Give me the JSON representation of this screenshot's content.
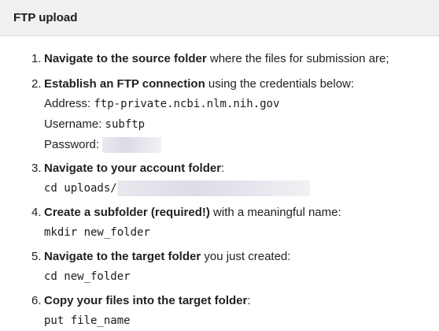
{
  "header": {
    "title": "FTP upload"
  },
  "steps": [
    {
      "num": "1.",
      "bold": "Navigate to the source folder",
      "rest": " where the files for submission are;"
    },
    {
      "num": "2.",
      "bold": "Establish an FTP connection",
      "rest": " using the credentials below:",
      "address_label": "Address:",
      "address_value": "ftp-private.ncbi.nlm.nih.gov",
      "username_label": "Username:",
      "username_value": "subftp",
      "password_label": "Password:"
    },
    {
      "num": "3.",
      "bold": "Navigate to your account folder",
      "rest": ":",
      "command": "cd uploads/"
    },
    {
      "num": "4.",
      "bold": "Create a subfolder (required!)",
      "rest": " with a meaningful name:",
      "command": "mkdir new_folder"
    },
    {
      "num": "5.",
      "bold": "Navigate to the target folder",
      "rest": " you just created:",
      "command": "cd new_folder"
    },
    {
      "num": "6.",
      "bold": "Copy your files into the target folder",
      "rest": ":",
      "command": "put file_name"
    }
  ]
}
